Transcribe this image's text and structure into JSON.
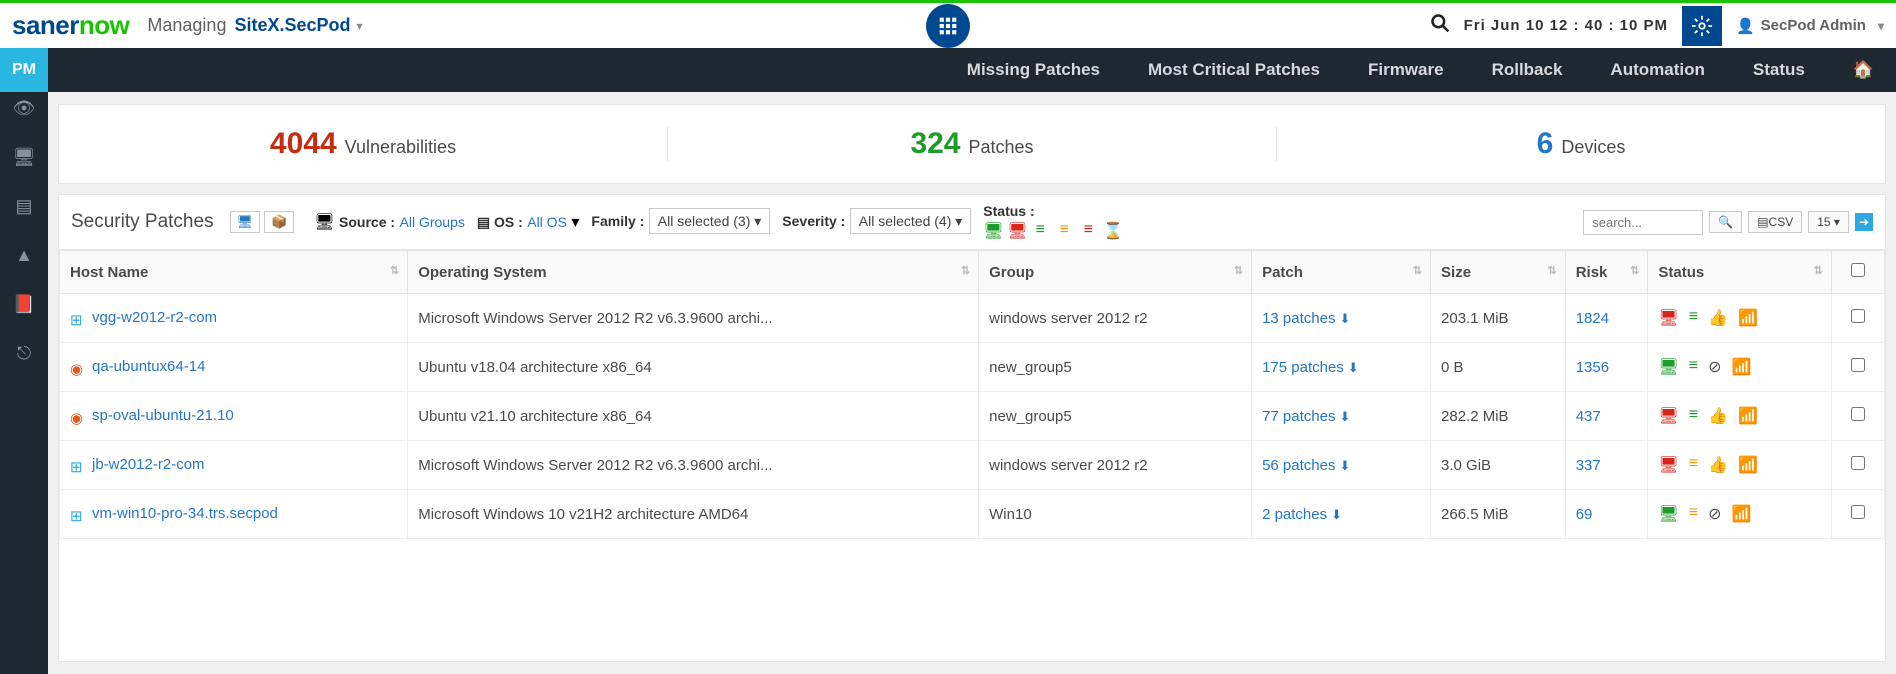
{
  "header": {
    "logo1": "saner",
    "logo2": "now",
    "managing": "Managing",
    "site": "SiteX.SecPod",
    "datetime": "Fri Jun 10  12 : 40 : 10 PM",
    "user": "SecPod Admin"
  },
  "nav": {
    "pm": "PM",
    "items": [
      "Missing Patches",
      "Most Critical Patches",
      "Firmware",
      "Rollback",
      "Automation",
      "Status"
    ]
  },
  "stats": [
    {
      "num": "4044",
      "label": "Vulnerabilities",
      "cls": "num-red"
    },
    {
      "num": "324",
      "label": "Patches",
      "cls": "num-green"
    },
    {
      "num": "6",
      "label": "Devices",
      "cls": "num-blue"
    }
  ],
  "filters": {
    "title": "Security Patches",
    "source_lbl": "Source :",
    "source_val": "All Groups",
    "os_lbl": "OS :",
    "os_val": "All OS",
    "family_lbl": "Family :",
    "family_sel": "All selected (3)",
    "sev_lbl": "Severity :",
    "sev_sel": "All selected (4)",
    "status_lbl": "Status :",
    "search_ph": "search...",
    "csv": "CSV",
    "pp": "15"
  },
  "cols": [
    "Host Name",
    "Operating System",
    "Group",
    "Patch",
    "Size",
    "Risk",
    "Status",
    ""
  ],
  "rows": [
    {
      "host": "vgg-w2012-r2-com",
      "os_icon": "win",
      "os": "Microsoft Windows Server 2012 R2 v6.3.9600 archi...",
      "group": "windows server 2012 r2",
      "patch": "13 patches",
      "size": "203.1 MiB",
      "risk": "1824",
      "st": [
        "r",
        "g",
        "thumb",
        "wifi"
      ]
    },
    {
      "host": "qa-ubuntux64-14",
      "os_icon": "ubu",
      "os": "Ubuntu v18.04 architecture x86_64",
      "group": "new_group5",
      "patch": "175 patches",
      "size": "0 B",
      "risk": "1356",
      "st": [
        "g",
        "g",
        "ban",
        "wifi"
      ]
    },
    {
      "host": "sp-oval-ubuntu-21.10",
      "os_icon": "ubu",
      "os": "Ubuntu v21.10 architecture x86_64",
      "group": "new_group5",
      "patch": "77 patches",
      "size": "282.2 MiB",
      "risk": "437",
      "st": [
        "r",
        "g",
        "thumb",
        "wifi"
      ]
    },
    {
      "host": "jb-w2012-r2-com",
      "os_icon": "win",
      "os": "Microsoft Windows Server 2012 R2 v6.3.9600 archi...",
      "group": "windows server 2012 r2",
      "patch": "56 patches",
      "size": "3.0 GiB",
      "risk": "337",
      "st": [
        "r",
        "o",
        "thumb",
        "wifi"
      ]
    },
    {
      "host": "vm-win10-pro-34.trs.secpod",
      "os_icon": "win",
      "os": "Microsoft Windows 10 v21H2 architecture AMD64",
      "group": "Win10",
      "patch": "2 patches",
      "size": "266.5 MiB",
      "risk": "69",
      "st": [
        "g",
        "o",
        "ban",
        "wifi"
      ]
    }
  ]
}
